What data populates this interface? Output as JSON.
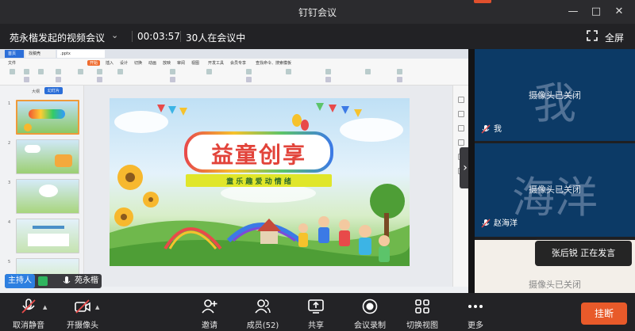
{
  "window": {
    "title": "钉钉会议"
  },
  "infobar": {
    "meeting_name": "苑永楷发起的视频会议",
    "timer": "00:03:57",
    "participants_status": "30人在会议中",
    "fullscreen_label": "全屏"
  },
  "shared_screen": {
    "wps_tabs": [
      "首页",
      "找稿壳",
      ".pptx"
    ],
    "menu": [
      "文件",
      "开始",
      "插入",
      "设计",
      "切换",
      "动画",
      "放映",
      "审阅",
      "视图",
      "开发工具",
      "会员专享",
      "查找命令、搜索模板"
    ],
    "active_menu": "开始",
    "thumb_tabs": [
      "大纲",
      "幻灯片"
    ],
    "slide_numbers": [
      "1",
      "2",
      "3",
      "4",
      "5"
    ],
    "slide_title": "益童创享",
    "slide_subtitle": "童 乐 趣  爱 动 情 绪"
  },
  "tiles": [
    {
      "big_char": "我",
      "camera_status": "摄像头已关闭",
      "name": "我"
    },
    {
      "big_char": "海洋",
      "camera_status": "摄像头已关闭",
      "name": "赵海洋"
    }
  ],
  "tile3": {
    "camera_status": "摄像头已关闭"
  },
  "speaking": {
    "text": "张后锐  正在发言"
  },
  "host_tag": {
    "badge": "主持人",
    "name": "苑永楷"
  },
  "toolbar": {
    "unmute": "取消静音",
    "camera": "开摄像头",
    "invite": "邀请",
    "members": "成员(52)",
    "share": "共享",
    "record": "会议录制",
    "switch_view": "切换视图",
    "more": "更多",
    "hangup": "挂断"
  },
  "colors": {
    "host_badge": "#2d7fe0",
    "hangup": "#e85a2a",
    "tile_bg": "#0c3a66",
    "wps_active": "#ef6c2f"
  }
}
